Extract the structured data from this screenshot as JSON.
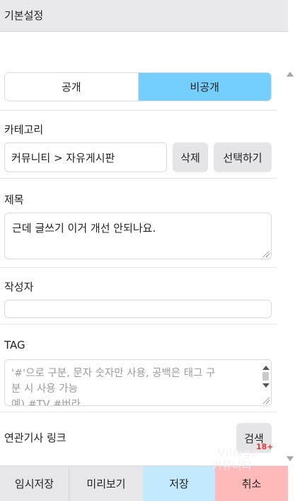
{
  "header": {
    "title": "기본설정"
  },
  "visibility": {
    "public_label": "공개",
    "private_label": "비공개",
    "selected": "비공개",
    "selected_color": "#74cffc"
  },
  "category": {
    "label": "카테고리",
    "value": "커뮤니티 > 자유게시판",
    "delete_label": "삭제",
    "select_label": "선택하기"
  },
  "title_field": {
    "label": "제목",
    "value": "근데 글쓰기 이거 개선 안되나요."
  },
  "author_field": {
    "label": "작성자",
    "value": ""
  },
  "tag_field": {
    "label": "TAG",
    "placeholder_lines": [
      "'#'으로 구분, 문자 숫자만 사용, 공백은 태그 구",
      "분 시 사용 가능",
      "예) #TV #버라"
    ]
  },
  "related_link": {
    "label": "연관기사 링크",
    "search_label": "검색"
  },
  "footer": {
    "temp_save_label": "임시저장",
    "preview_label": "미리보기",
    "save_label": "저장",
    "cancel_label": "취소",
    "save_color": "#c2e9fd",
    "cancel_color": "#feb9b9"
  },
  "watermark": {
    "line1": "Village",
    "line2": "커뮤니티",
    "badge": "18+"
  }
}
